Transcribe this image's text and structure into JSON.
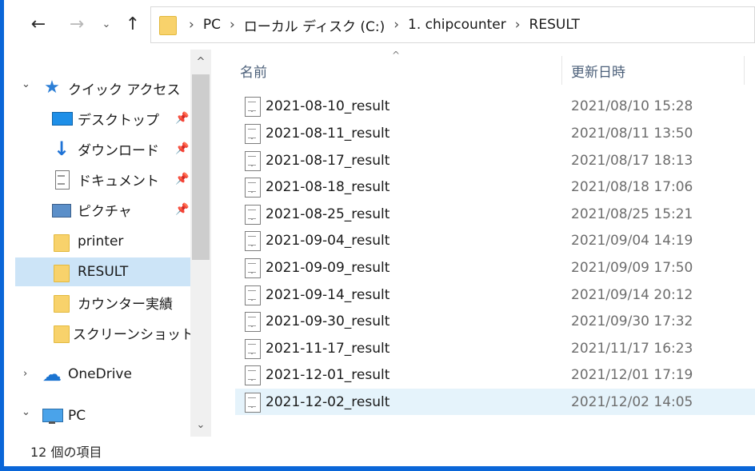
{
  "nav": {
    "back_icon": "arrow-left-icon",
    "forward_icon": "arrow-right-icon",
    "recent_icon": "chevron-down-icon",
    "up_icon": "arrow-up-icon"
  },
  "address": {
    "crumbs": [
      "PC",
      "ローカル ディスク (C:)",
      "1. chipcounter",
      "RESULT"
    ]
  },
  "sidebar": {
    "items": [
      {
        "label": "クイック アクセス",
        "icon": "star-icon"
      },
      {
        "label": "デスクトップ",
        "icon": "desktop-icon",
        "pinned": true
      },
      {
        "label": "ダウンロード",
        "icon": "download-icon",
        "pinned": true
      },
      {
        "label": "ドキュメント",
        "icon": "document-icon",
        "pinned": true
      },
      {
        "label": "ピクチャ",
        "icon": "pictures-icon",
        "pinned": true
      },
      {
        "label": "printer",
        "icon": "folder-icon"
      },
      {
        "label": "RESULT",
        "icon": "folder-icon",
        "selected": true
      },
      {
        "label": "カウンター実績",
        "icon": "folder-icon"
      },
      {
        "label": "スクリーンショット",
        "icon": "folder-icon"
      },
      {
        "label": "OneDrive",
        "icon": "cloud-icon"
      },
      {
        "label": "PC",
        "icon": "computer-icon"
      }
    ]
  },
  "list": {
    "columns": {
      "name": "名前",
      "modified": "更新日時"
    },
    "rows": [
      {
        "name": "2021-08-10_result",
        "modified": "2021/08/10 15:28"
      },
      {
        "name": "2021-08-11_result",
        "modified": "2021/08/11 13:50"
      },
      {
        "name": "2021-08-17_result",
        "modified": "2021/08/17 18:13"
      },
      {
        "name": "2021-08-18_result",
        "modified": "2021/08/18 17:06"
      },
      {
        "name": "2021-08-25_result",
        "modified": "2021/08/25 15:21"
      },
      {
        "name": "2021-09-04_result",
        "modified": "2021/09/04 14:19"
      },
      {
        "name": "2021-09-09_result",
        "modified": "2021/09/09 17:50"
      },
      {
        "name": "2021-09-14_result",
        "modified": "2021/09/14 20:12"
      },
      {
        "name": "2021-09-30_result",
        "modified": "2021/09/30 17:32"
      },
      {
        "name": "2021-11-17_result",
        "modified": "2021/11/17 16:23"
      },
      {
        "name": "2021-12-01_result",
        "modified": "2021/12/01 17:19"
      },
      {
        "name": "2021-12-02_result",
        "modified": "2021/12/02 14:05"
      }
    ]
  },
  "status": {
    "item_count": "12 個の項目"
  },
  "colors": {
    "accent": "#0a66d8",
    "selection": "#cce4f7",
    "hover": "#e5f3fb",
    "folder": "#f8d26b"
  }
}
